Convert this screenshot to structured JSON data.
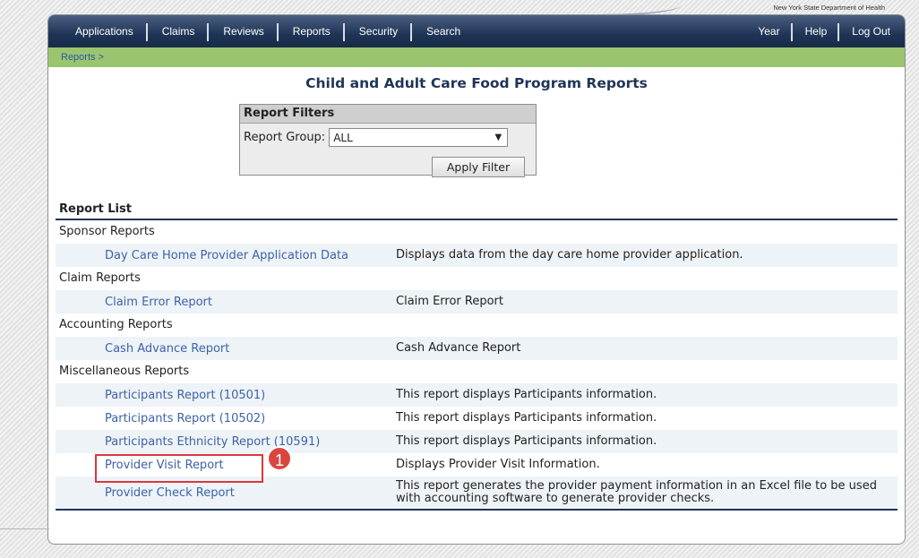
{
  "header": {
    "agency": "New York State Department of Health"
  },
  "nav": {
    "left": [
      "Applications",
      "Claims",
      "Reviews",
      "Reports",
      "Security",
      "Search"
    ],
    "right": [
      "Year",
      "Help",
      "Log Out"
    ]
  },
  "breadcrumb": "Reports >",
  "page_title": "Child and Adult Care Food Program Reports",
  "filters": {
    "heading": "Report Filters",
    "group_label": "Report Group:",
    "group_value": "ALL",
    "apply_label": "Apply Filter"
  },
  "report_list": {
    "heading": "Report List",
    "groups": [
      {
        "name": "Sponsor Reports",
        "reports": [
          {
            "link": "Day Care Home Provider Application Data",
            "desc": "Displays data from the day care home provider application."
          }
        ]
      },
      {
        "name": "Claim Reports",
        "reports": [
          {
            "link": "Claim Error Report",
            "desc": "Claim Error Report"
          }
        ]
      },
      {
        "name": "Accounting Reports",
        "reports": [
          {
            "link": "Cash Advance Report",
            "desc": "Cash Advance Report"
          }
        ]
      },
      {
        "name": "Miscellaneous Reports",
        "reports": [
          {
            "link": "Participants Report (10501)",
            "desc": "This report displays Participants information."
          },
          {
            "link": "Participants Report (10502)",
            "desc": "This report displays Participants information."
          },
          {
            "link": "Participants Ethnicity Report (10591)",
            "desc": "This report displays Participants information."
          },
          {
            "link": "Provider Visit Report",
            "desc": "Displays Provider Visit Information."
          },
          {
            "link": "Provider Check Report",
            "desc": "This report generates the provider payment information in an Excel file to be used with accounting software to generate provider checks."
          }
        ]
      }
    ]
  },
  "annotation": {
    "step": "1",
    "color": "#d9383c"
  }
}
